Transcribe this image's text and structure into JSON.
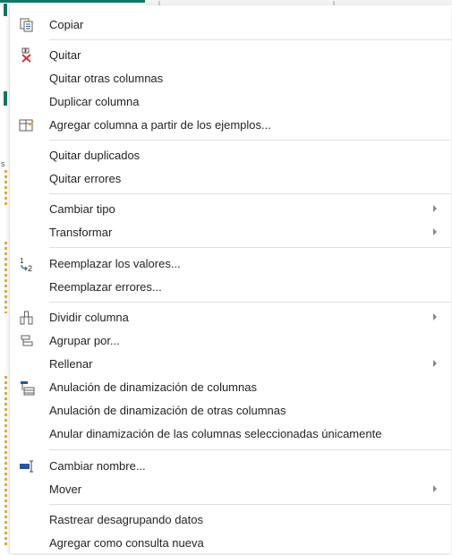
{
  "context_menu": {
    "items": [
      {
        "id": "copy",
        "label": "Copiar",
        "icon": "copy-icon"
      },
      {
        "id": "remove",
        "label": "Quitar",
        "icon": "remove-column-icon"
      },
      {
        "id": "remove_other",
        "label": "Quitar otras columnas"
      },
      {
        "id": "duplicate",
        "label": "Duplicar columna"
      },
      {
        "id": "add_from_examples",
        "label": "Agregar columna a partir de los ejemplos...",
        "icon": "column-from-examples-icon"
      },
      {
        "id": "remove_duplicates",
        "label": "Quitar duplicados"
      },
      {
        "id": "remove_errors",
        "label": "Quitar errores"
      },
      {
        "id": "change_type",
        "label": "Cambiar tipo",
        "submenu": true
      },
      {
        "id": "transform",
        "label": "Transformar",
        "submenu": true
      },
      {
        "id": "replace_values",
        "label": "Reemplazar los valores...",
        "icon": "replace-values-icon"
      },
      {
        "id": "replace_errors",
        "label": "Reemplazar errores..."
      },
      {
        "id": "split_column",
        "label": "Dividir columna",
        "icon": "split-column-icon",
        "submenu": true
      },
      {
        "id": "group_by",
        "label": "Agrupar por...",
        "icon": "group-by-icon"
      },
      {
        "id": "fill",
        "label": "Rellenar",
        "submenu": true
      },
      {
        "id": "unpivot",
        "label": "Anulación de dinamización de columnas",
        "icon": "unpivot-icon"
      },
      {
        "id": "unpivot_other",
        "label": "Anulación de dinamización de otras columnas"
      },
      {
        "id": "unpivot_selected",
        "label": "Anular dinamización de las columnas seleccionadas únicamente"
      },
      {
        "id": "rename",
        "label": "Cambiar nombre...",
        "icon": "rename-icon"
      },
      {
        "id": "move",
        "label": "Mover",
        "submenu": true
      },
      {
        "id": "drill_down",
        "label": "Rastrear desagrupando datos"
      },
      {
        "id": "add_as_query",
        "label": "Agregar como consulta nueva"
      }
    ]
  },
  "background": {
    "partial_letter": "s"
  },
  "colors": {
    "text": "#252423",
    "separator": "#e1dfdd",
    "remove_icon_red": "#d13438",
    "icon_blue": "#2b579a",
    "icon_gray": "#605e5c",
    "accent_teal": "#117865"
  }
}
